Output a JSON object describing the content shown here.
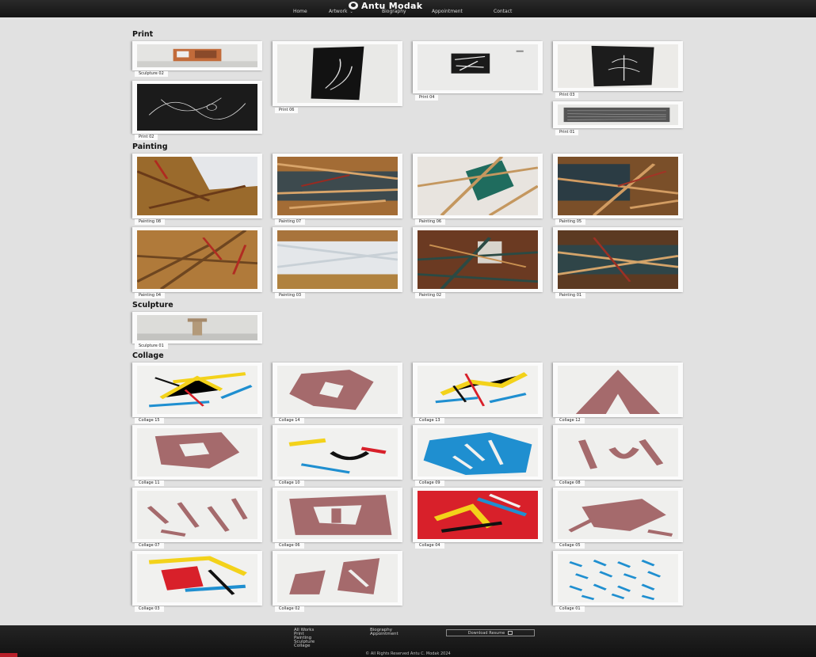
{
  "header": {
    "brand": "Antu Modak",
    "nav": [
      {
        "label": "Home"
      },
      {
        "label": "Artwork",
        "dropdown": true
      },
      {
        "label": "Biography"
      },
      {
        "label": "Appointment"
      },
      {
        "label": "Contact"
      }
    ]
  },
  "sections": {
    "print": {
      "title": "Print",
      "items": [
        {
          "caption": "Sculpture 02",
          "icon": "sculpture-photo"
        },
        {
          "caption": "Print 06",
          "icon": "print-artwork"
        },
        {
          "caption": "Print 04",
          "icon": "print-artwork"
        },
        {
          "caption": "Print 03",
          "icon": "print-artwork"
        },
        {
          "caption": "Print 02",
          "icon": "print-artwork"
        },
        {
          "caption": "Print 01",
          "icon": "print-artwork"
        }
      ]
    },
    "painting": {
      "title": "Painting",
      "items": [
        {
          "caption": "Painting 08"
        },
        {
          "caption": "Painting 07"
        },
        {
          "caption": "Painting 06"
        },
        {
          "caption": "Painting 05"
        },
        {
          "caption": "Painting 04"
        },
        {
          "caption": "Painting 03"
        },
        {
          "caption": "Painting 02"
        },
        {
          "caption": "Painting 01"
        }
      ]
    },
    "sculpture": {
      "title": "Sculpture",
      "items": [
        {
          "caption": "Sculpture 01"
        }
      ]
    },
    "collage": {
      "title": "Collage",
      "items": [
        {
          "caption": "Collage 15"
        },
        {
          "caption": "Collage 14"
        },
        {
          "caption": "Collage 13"
        },
        {
          "caption": "Collage 12"
        },
        {
          "caption": "Collage 11"
        },
        {
          "caption": "Collage 10"
        },
        {
          "caption": "Collage 09"
        },
        {
          "caption": "Collage 08"
        },
        {
          "caption": "Collage 07"
        },
        {
          "caption": "Collage 06"
        },
        {
          "caption": "Collage 04"
        },
        {
          "caption": "Collage 05"
        },
        {
          "caption": "Collage 03"
        },
        {
          "caption": "Collage 02"
        },
        {
          "caption": "Collage 01"
        }
      ]
    }
  },
  "footer": {
    "works_links": [
      "All Works",
      "Print",
      "Painting",
      "Sculpture",
      "Collage"
    ],
    "info_links": [
      "Biography",
      "Appointment"
    ],
    "download_label": "Download Resume",
    "copyright": "© All Rights Reserved Antu C. Modak 2024"
  },
  "colors": {
    "page_bg": "#e1e1e1",
    "header_bg": "#1b1b1b",
    "footer_bg": "#1b1b1b",
    "collage_mauve": "#a56a6c",
    "collage_red": "#d8202a",
    "collage_yellow": "#f3d21a",
    "collage_blue": "#1f8fd0"
  }
}
